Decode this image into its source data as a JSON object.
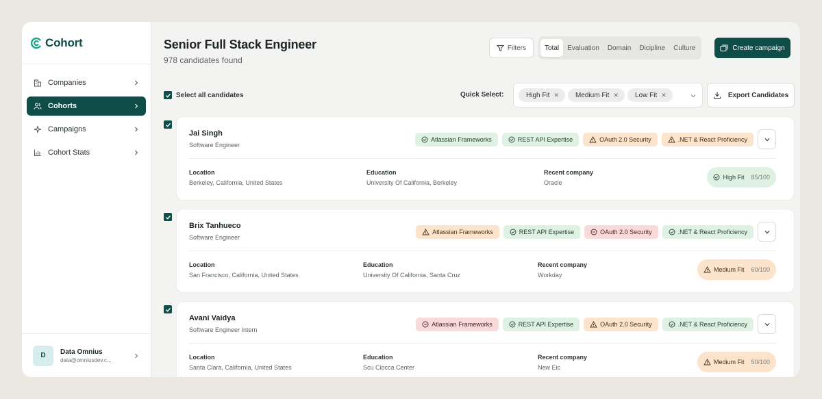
{
  "brand": {
    "name": "Cohort",
    "accent": "#0f4d48"
  },
  "sidebar": {
    "items": [
      {
        "label": "Companies",
        "icon": "building-icon",
        "active": false
      },
      {
        "label": "Cohorts",
        "icon": "users-icon",
        "active": true
      },
      {
        "label": "Campaigns",
        "icon": "sparkle-icon",
        "active": false
      },
      {
        "label": "Cohort Stats",
        "icon": "bar-chart-icon",
        "active": false
      }
    ],
    "user": {
      "initial": "D",
      "name": "Data Omnius",
      "email": "data@omniusdev.c..."
    }
  },
  "header": {
    "title": "Senior Full Stack Engineer",
    "subtitle": "978 candidates found",
    "filters_label": "Filters",
    "tabs": [
      "Total",
      "Evaluation",
      "Domain",
      "Dicipline",
      "Culture"
    ],
    "active_tab": "Total",
    "create_label": "Create campaign"
  },
  "toolbar": {
    "select_all_label": "Select all candidates",
    "quick_select_label": "Quick Select:",
    "chips": [
      "High Fit",
      "Medium Fit",
      "Low Fit"
    ],
    "export_label": "Export Candidates"
  },
  "field_labels": {
    "location": "Location",
    "education": "Education",
    "company": "Recent company"
  },
  "candidates": [
    {
      "name": "Jai Singh",
      "role": "Software Engineer",
      "tags": [
        {
          "label": "Atlassian Frameworks",
          "status": "green"
        },
        {
          "label": "REST API Expertise",
          "status": "green"
        },
        {
          "label": "OAuth 2.0 Security",
          "status": "orange"
        },
        {
          "label": ".NET & React Proficiency",
          "status": "orange"
        }
      ],
      "location": "Berkeley, California, United States",
      "education": "University Of California, Berkeley",
      "company": "Oracle",
      "fit": "High Fit",
      "fit_level": "high",
      "score": "85/100"
    },
    {
      "name": "Brix Tanhueco",
      "role": "Software Engineer",
      "tags": [
        {
          "label": "Atlassian Frameworks",
          "status": "orange"
        },
        {
          "label": "REST API Expertise",
          "status": "green"
        },
        {
          "label": "OAuth 2.0 Security",
          "status": "red"
        },
        {
          "label": ".NET & React Proficiency",
          "status": "green"
        }
      ],
      "location": "San Francisco, California, United States",
      "education": "University Of California, Santa Cruz",
      "company": "Workday",
      "fit": "Medium Fit",
      "fit_level": "med",
      "score": "60/100"
    },
    {
      "name": "Avani Vaidya",
      "role": "Software Engineer Intern",
      "tags": [
        {
          "label": "Atlassian Frameworks",
          "status": "red"
        },
        {
          "label": "REST API Expertise",
          "status": "green"
        },
        {
          "label": "OAuth 2.0 Security",
          "status": "orange"
        },
        {
          "label": ".NET & React Proficiency",
          "status": "green"
        }
      ],
      "location": "Santa Clara, California, United States",
      "education": "Scu Ciocca Center",
      "company": "New Eic",
      "fit": "Medium Fit",
      "fit_level": "med",
      "score": "50/100"
    }
  ]
}
